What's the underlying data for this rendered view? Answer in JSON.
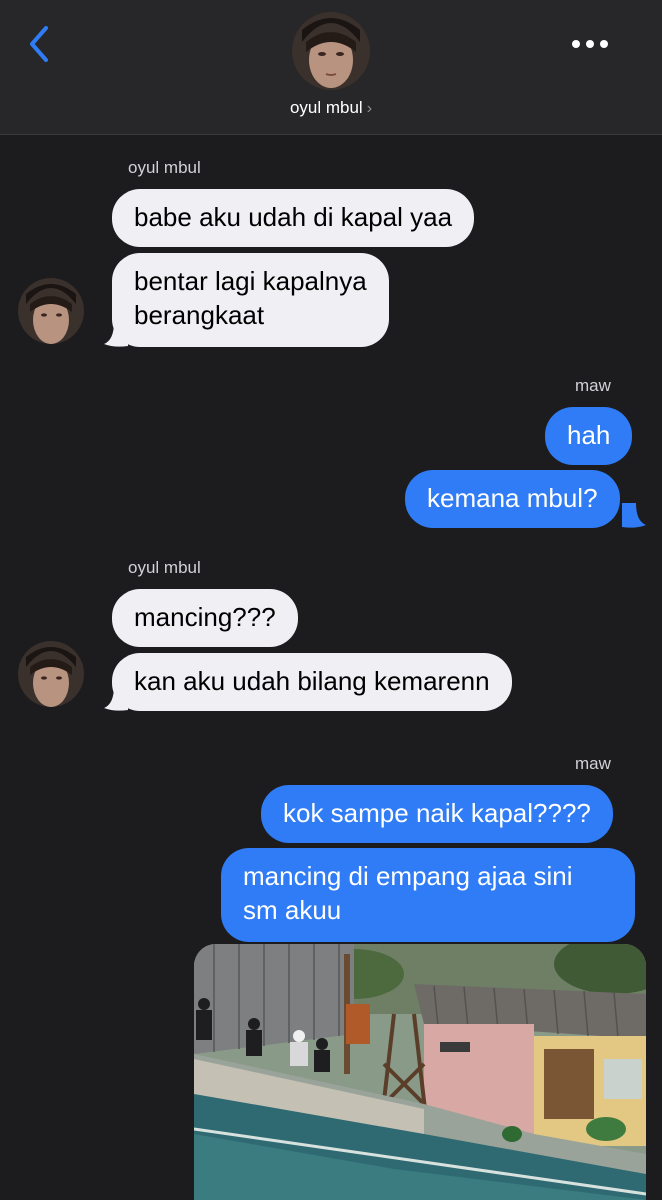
{
  "header": {
    "contact_name": "oyul mbul",
    "chevron": "›",
    "back_icon": "chevron-left-icon",
    "more_icon": "ellipsis-icon",
    "accent": "#2f7cf6"
  },
  "groups": [
    {
      "sender": "oyul mbul",
      "messages": [
        "babe aku udah di kapal yaa",
        "bentar lagi kapalnya",
        "berangkaat"
      ]
    },
    {
      "sender": "maw",
      "messages": [
        "hah",
        "kemana mbul?"
      ]
    },
    {
      "sender": "oyul mbul",
      "messages": [
        "mancing???",
        "kan aku udah bilang kemarenn"
      ]
    },
    {
      "sender": "maw",
      "messages": [
        "kok sampe naik kapal????",
        "mancing di empang ajaa sini",
        "sm akuu"
      ]
    }
  ],
  "colors": {
    "background": "#1c1c1e",
    "incoming_bubble": "#efeff4",
    "outgoing_bubble": "#2f7cf6"
  }
}
